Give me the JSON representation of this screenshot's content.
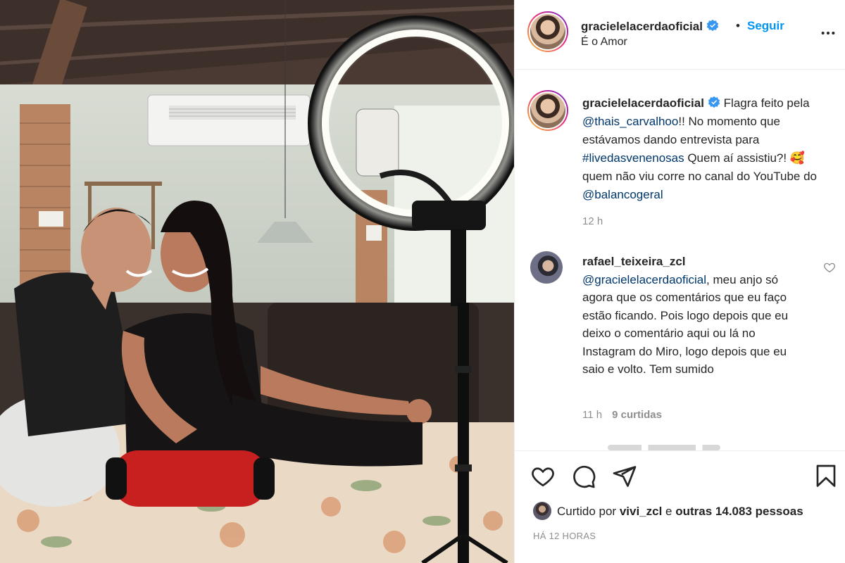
{
  "post": {
    "author": "gracielelacerdaoficial",
    "follow_label": "Seguir",
    "location": "É o Amor",
    "separator": "•"
  },
  "caption": {
    "author": "gracielelacerdaoficial",
    "part1": " Flagra feito pela ",
    "mention1": "@thais_carvalhoo",
    "part2": "!! No momento que estávamos dando entrevista para ",
    "hashtag": "#livedasvenenosas",
    "part3": " Quem aí assistiu?! ",
    "emoji": "🥰",
    "part4": " quem não viu corre no canal do YouTube do ",
    "mention2": "@balancogeral",
    "time": "12 h"
  },
  "reply": {
    "author": "rafael_teixeira_zcl",
    "mention": "@gracielelacerdaoficial",
    "text": ", meu anjo só agora que os comentários que eu faço estão ficando. Pois logo depois que eu deixo o comentário aqui ou lá no Instagram do Miro, logo depois que eu saio e volto. Tem sumido",
    "time": "11 h",
    "likes": "9 curtidas"
  },
  "likes": {
    "prefix": "Curtido por ",
    "user": "vivi_zcl",
    "middle": " e ",
    "others": "outras 14.083 pessoas"
  },
  "timestamp": "HÁ 12 HORAS",
  "colors": {
    "link": "#00376b",
    "follow": "#0095f6",
    "verified": "#3897f0",
    "muted": "#8e8e8e"
  },
  "icons": [
    "verified-icon",
    "more-options-icon",
    "heart-icon",
    "comment-icon",
    "share-icon",
    "bookmark-icon"
  ]
}
